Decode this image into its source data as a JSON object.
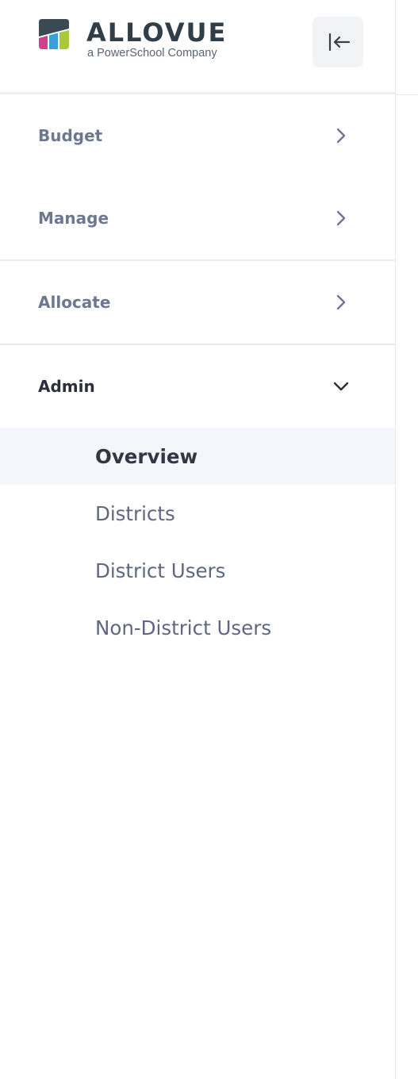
{
  "brand": {
    "name": "ALLOVUE",
    "tagline": "a PowerSchool Company",
    "colors": {
      "dark": "#3a4a55",
      "pink": "#d23f8c",
      "blue": "#3aa0d8",
      "green": "#a7c93b",
      "text": "#2f3e48"
    }
  },
  "header": {
    "collapse_icon": "collapse-left-icon"
  },
  "nav": {
    "groups": [
      {
        "label": "Budget",
        "icon": "chevron-right-icon",
        "expanded": false
      },
      {
        "label": "Manage",
        "icon": "chevron-right-icon",
        "expanded": false
      },
      {
        "label": "Allocate",
        "icon": "chevron-right-icon",
        "expanded": false
      },
      {
        "label": "Admin",
        "icon": "chevron-down-icon",
        "expanded": true,
        "items": [
          {
            "label": "Overview",
            "active": true
          },
          {
            "label": "Districts",
            "active": false
          },
          {
            "label": "District Users",
            "active": false
          },
          {
            "label": "Non-District Users",
            "active": false
          }
        ]
      }
    ]
  },
  "theme": {
    "label_color": "#6d7790",
    "active_label_color": "#2a2f3a",
    "active_bg": "#f5f6fc",
    "divider": "#e8eaee"
  }
}
